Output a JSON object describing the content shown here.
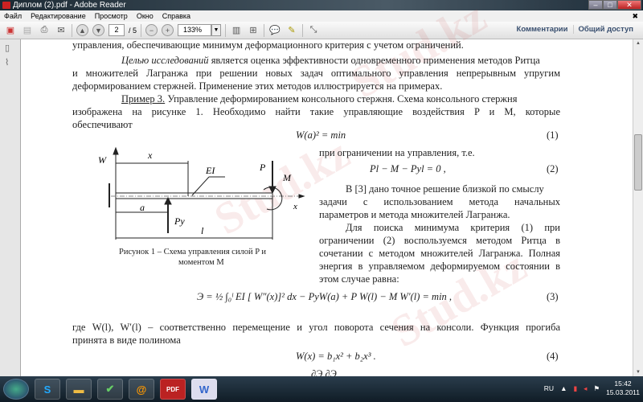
{
  "window": {
    "title": "Диплом (2).pdf - Adobe Reader",
    "min": "–",
    "max": "□",
    "close": "✕"
  },
  "menu": [
    "Файл",
    "Редактирование",
    "Просмотр",
    "Окно",
    "Справка"
  ],
  "menu_close": "✖",
  "toolbar": {
    "page_current": "2",
    "page_total": "/ 5",
    "zoom": "133%",
    "comments": "Комментарии",
    "share": "Общий доступ"
  },
  "doc": {
    "l1": "управления, обеспечивающие минимум деформационного критерия с учетом ограничений.",
    "l2a": "Целью исследований",
    "l2b": " является оценка эффективности одновременного применения методов Ритца",
    "l3": "и множителей Лагранжа при решении новых задач оптимального управления непрерывным упругим",
    "l4": "деформированием стержней. Применение этих методов иллюстрируется на примерах.",
    "l5a": "Пример 3.",
    "l5b": " Управление деформированием консольного стержня. Схема консольного стержня",
    "l6": "изображена на рисунке 1. Необходимо найти такие управляющие воздействия P и M, которые",
    "l7": "обеспечивают",
    "eq1": "W(a)² = min",
    "eq1n": "(1)",
    "r1": "при ограничении на управления, т.е.",
    "eq2": "Pl − M − Pyl = 0 ,",
    "eq2n": "(2)",
    "r2": "В [3] дано точное решение близкой по смыслу",
    "r3": "задачи с использованием метода начальных",
    "r4": "параметров и метода множителей Лагранжа.",
    "r5": "Для поиска минимума критерия (1) при",
    "r6": "ограничении (2) воспользуемся методом Ритца в",
    "r7": "сочетании с методом множителей Лагранжа. Полная",
    "r8": "энергия в управляемом деформируемом состоянии в",
    "r9": "этом случае равна:",
    "eq3": "Э = ½ ∫₀ˡ EI [ W″(x)]² dx − PyW(a) + P W(l) − M W′(l) = min ,",
    "eq3n": "(3)",
    "l8": "где W(l), W′(l) – соответственно перемещение и угол поворота сечения на консоли. Функция прогиба",
    "l9": "принята в виде полинома",
    "eq4": "W(x) = b₁x² + b₂x³ .",
    "eq4n": "(4)",
    "partial": "∂Э        ∂Э"
  },
  "figure": {
    "W": "W",
    "x": "x",
    "EI": "EI",
    "P": "P",
    "M": "M",
    "a": "a",
    "Py": "Py",
    "l": "l",
    "xaxis": "x",
    "caption1": "Рисунок 1 – Схема управления силой  P  и",
    "caption2": "моментом M"
  },
  "watermark": "Stud.kz",
  "taskbar": {
    "apps": [
      "start",
      "S",
      "folder",
      "✔",
      "@",
      "PDF",
      "W"
    ],
    "lang": "RU",
    "time": "15:42",
    "date": "15.03.2011"
  }
}
